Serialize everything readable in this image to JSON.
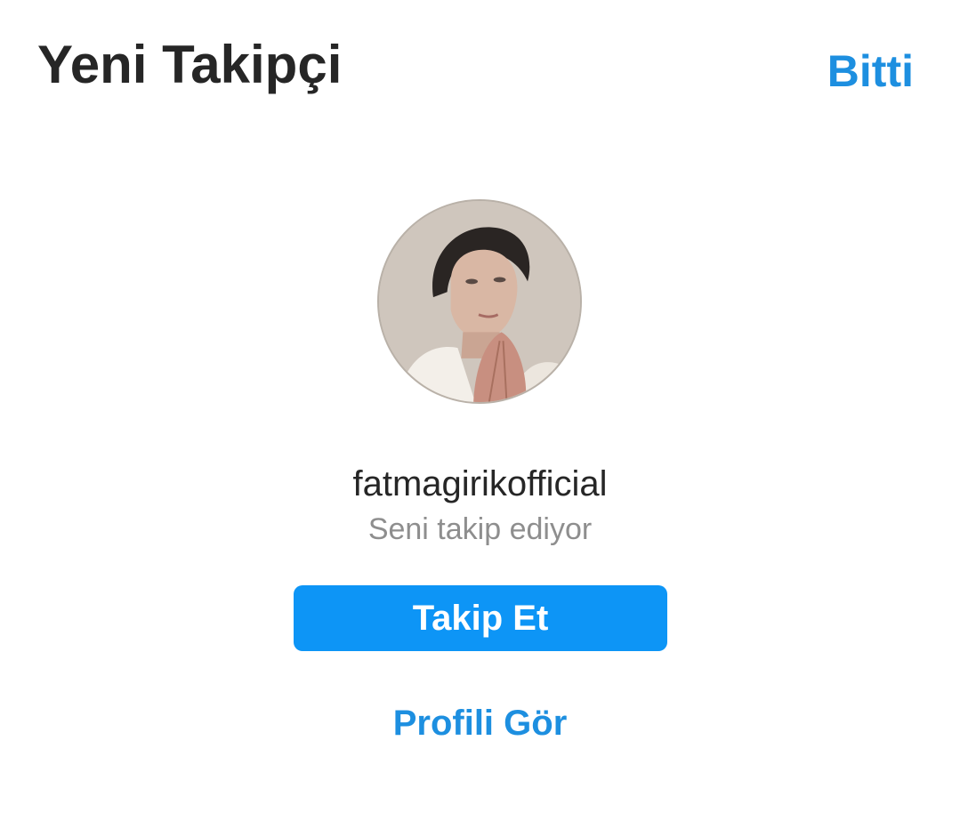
{
  "header": {
    "title": "Yeni Takipçi",
    "done_label": "Bitti"
  },
  "profile": {
    "username": "fatmagirikofficial",
    "status_text": "Seni takip ediyor",
    "avatar_icon": "profile-photo"
  },
  "actions": {
    "follow_label": "Takip Et",
    "view_profile_label": "Profili Gör"
  },
  "colors": {
    "accent": "#1d8fe0",
    "button_bg": "#0d95f6",
    "title_text": "#262626",
    "secondary_text": "#8e8e8e"
  }
}
